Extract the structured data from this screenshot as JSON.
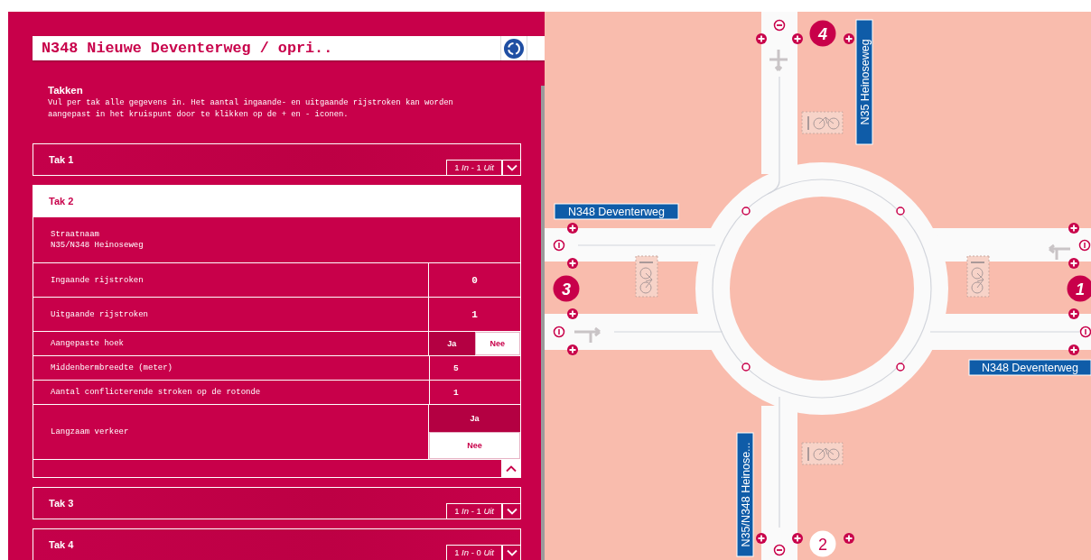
{
  "panel": {
    "title": "N348 Nieuwe Deventerweg / opri..",
    "section_title": "Takken",
    "description": "Vul per tak alle gegevens in. Het aantal ingaande- en uitgaande rijstroken kan worden aangepast in het kruispunt door te klikken op de + en - iconen.",
    "branches": [
      {
        "title": "Tak 1",
        "expanded": false,
        "summary": "1 *In* - 1 *Uit*"
      },
      {
        "title": "Tak 2",
        "expanded": true,
        "fields": [
          {
            "kind": "text",
            "label": "Straatnaam",
            "value": "N35/N348 Heinoseweg"
          },
          {
            "kind": "number",
            "label": "Ingaande rijstroken",
            "value": "0"
          },
          {
            "kind": "number",
            "label": "Uitgaande rijstroken",
            "value": "1"
          },
          {
            "kind": "choice",
            "label": "Aangepaste hoek",
            "options": [
              {
                "label": "Ja",
                "selected": false
              },
              {
                "label": "Nee",
                "selected": true
              }
            ]
          },
          {
            "kind": "small-number",
            "label": "Middenbermbreedte (meter)",
            "value": "5"
          },
          {
            "kind": "small-number",
            "label": "Aantal conflicterende stroken op de rotonde",
            "value": "1"
          },
          {
            "kind": "choice-stacked",
            "label": "Langzaam verkeer",
            "options": [
              {
                "label": "Ja",
                "selected": false
              },
              {
                "label": "Nee",
                "selected": true
              }
            ]
          }
        ]
      },
      {
        "title": "Tak 3",
        "expanded": false,
        "summary": "1 *In* - 1 *Uit*"
      },
      {
        "title": "Tak 4",
        "expanded": false,
        "summary": "1 *In* - 0 *Uit*"
      }
    ]
  },
  "map": {
    "branches": [
      {
        "number": "4",
        "selected": false
      },
      {
        "number": "3",
        "selected": false
      },
      {
        "number": "1",
        "selected": false
      },
      {
        "number": "2",
        "selected": true
      }
    ],
    "road_labels": [
      {
        "text": "N35 Heinoseweg",
        "kind": "vertical"
      },
      {
        "text": "N348 Deventerweg",
        "kind": "horizontal"
      },
      {
        "text": "N348 Deventerweg",
        "kind": "horizontal"
      },
      {
        "text": "N35/N348 Heinose...",
        "kind": "vertical"
      }
    ]
  }
}
